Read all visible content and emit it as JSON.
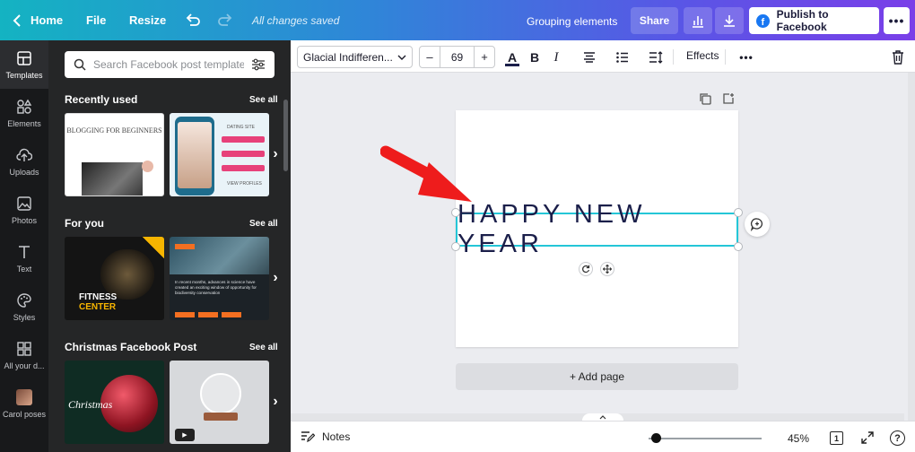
{
  "topbar": {
    "home": "Home",
    "file": "File",
    "resize": "Resize",
    "saved_status": "All changes saved",
    "document_title": "Grouping elements",
    "share": "Share",
    "publish": "Publish to Facebook",
    "more": "•••",
    "icons": [
      "chevron-left-icon",
      "undo-icon",
      "redo-icon",
      "chart-icon",
      "download-icon",
      "facebook-icon"
    ]
  },
  "rail": {
    "items": [
      {
        "label": "Templates",
        "icon": "templates-icon"
      },
      {
        "label": "Elements",
        "icon": "elements-icon"
      },
      {
        "label": "Uploads",
        "icon": "upload-icon"
      },
      {
        "label": "Photos",
        "icon": "photos-icon"
      },
      {
        "label": "Text",
        "icon": "text-icon"
      },
      {
        "label": "Styles",
        "icon": "palette-icon"
      },
      {
        "label": "All your d...",
        "icon": "grid-icon"
      },
      {
        "label": "Carol poses",
        "icon": "avatar"
      }
    ]
  },
  "panel": {
    "search_placeholder": "Search Facebook post templates",
    "sections": [
      {
        "title": "Recently used",
        "see_all": "See all"
      },
      {
        "title": "For you",
        "see_all": "See all"
      },
      {
        "title": "Christmas Facebook Post",
        "see_all": "See all"
      }
    ],
    "thumbs": {
      "blog_title": "BLOGGING FOR BEGINNERS",
      "dating_title": "DATING SITE",
      "dating_button": "VIEW PROFILES",
      "fitness_line1": "FITNESS",
      "fitness_line2": "CENTER",
      "science_text": "In recent months, advances in science have created an exciting window of opportunity for biodiversity conservation",
      "xmas_text": "Christmas"
    }
  },
  "toolbar": {
    "font_name": "Glacial Indifferen...",
    "font_size": "69",
    "minus": "–",
    "plus": "+",
    "text_color_glyph": "A",
    "bold_glyph": "B",
    "italic_glyph": "I",
    "effects": "Effects",
    "more": "•••",
    "text_color_hex": "#1b1f4a"
  },
  "canvas": {
    "text": "HAPPY NEW YEAR",
    "text_color": "#1b1f4a",
    "selection_color": "#24c6d7",
    "arrow_color": "#ee1c1c",
    "add_page": "+ Add page"
  },
  "bottombar": {
    "notes": "Notes",
    "zoom": "45%",
    "page_count": "1",
    "help": "?",
    "zoom_fraction": 0.02
  }
}
